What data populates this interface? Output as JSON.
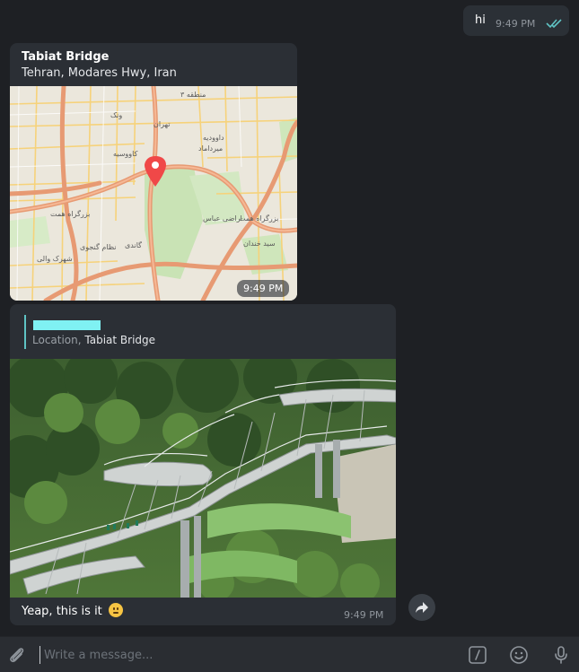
{
  "messages": {
    "outgoing": {
      "text": "hi",
      "time": "9:49 PM",
      "status_icon": "double-check-icon"
    },
    "location": {
      "title": "Tabiat Bridge",
      "address": "Tehran, Modares Hwy, Iran",
      "time": "9:49 PM"
    },
    "photo": {
      "reply_prefix": "Location,",
      "reply_target": "Tabiat Bridge",
      "caption": "Yeap, this is it",
      "time": "9:49 PM"
    }
  },
  "composer": {
    "placeholder": "Write a message..."
  },
  "colors": {
    "background": "#1e2024",
    "bubble": "#2b2f35",
    "accent": "#5fc3c4",
    "pin": "#f04848"
  }
}
